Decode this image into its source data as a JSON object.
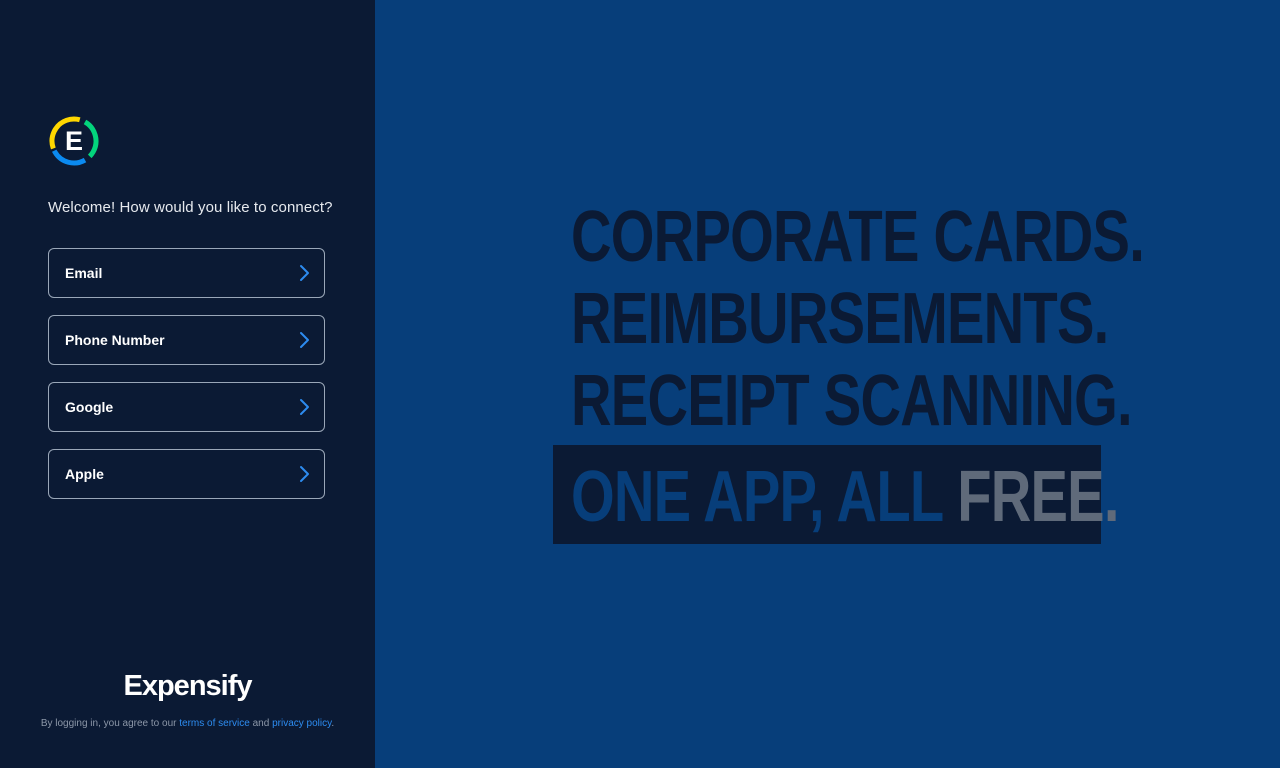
{
  "sidebar": {
    "logo_icon": "expensify-e-logo-icon",
    "welcome": "Welcome! How would you like to connect?",
    "options": [
      {
        "label": "Email",
        "icon": "chevron-right-icon"
      },
      {
        "label": "Phone Number",
        "icon": "chevron-right-icon"
      },
      {
        "label": "Google",
        "icon": "chevron-right-icon"
      },
      {
        "label": "Apple",
        "icon": "chevron-right-icon"
      }
    ],
    "wordmark": "Expensify",
    "legal": {
      "prefix": "By logging in, you agree to our ",
      "terms": "terms of service",
      "middle": " and ",
      "privacy": "privacy policy",
      "suffix": "."
    }
  },
  "hero": {
    "lines": [
      "CORPORATE CARDS.",
      "REIMBURSEMENTS.",
      "RECEIPT SCANNING."
    ],
    "final_highlight": "ONE APP, ALL ",
    "final_emphasis": "FREE."
  },
  "colors": {
    "sidebar_bg": "#0b1a34",
    "main_bg": "#073e7a",
    "accent": "#2d8cf0"
  }
}
